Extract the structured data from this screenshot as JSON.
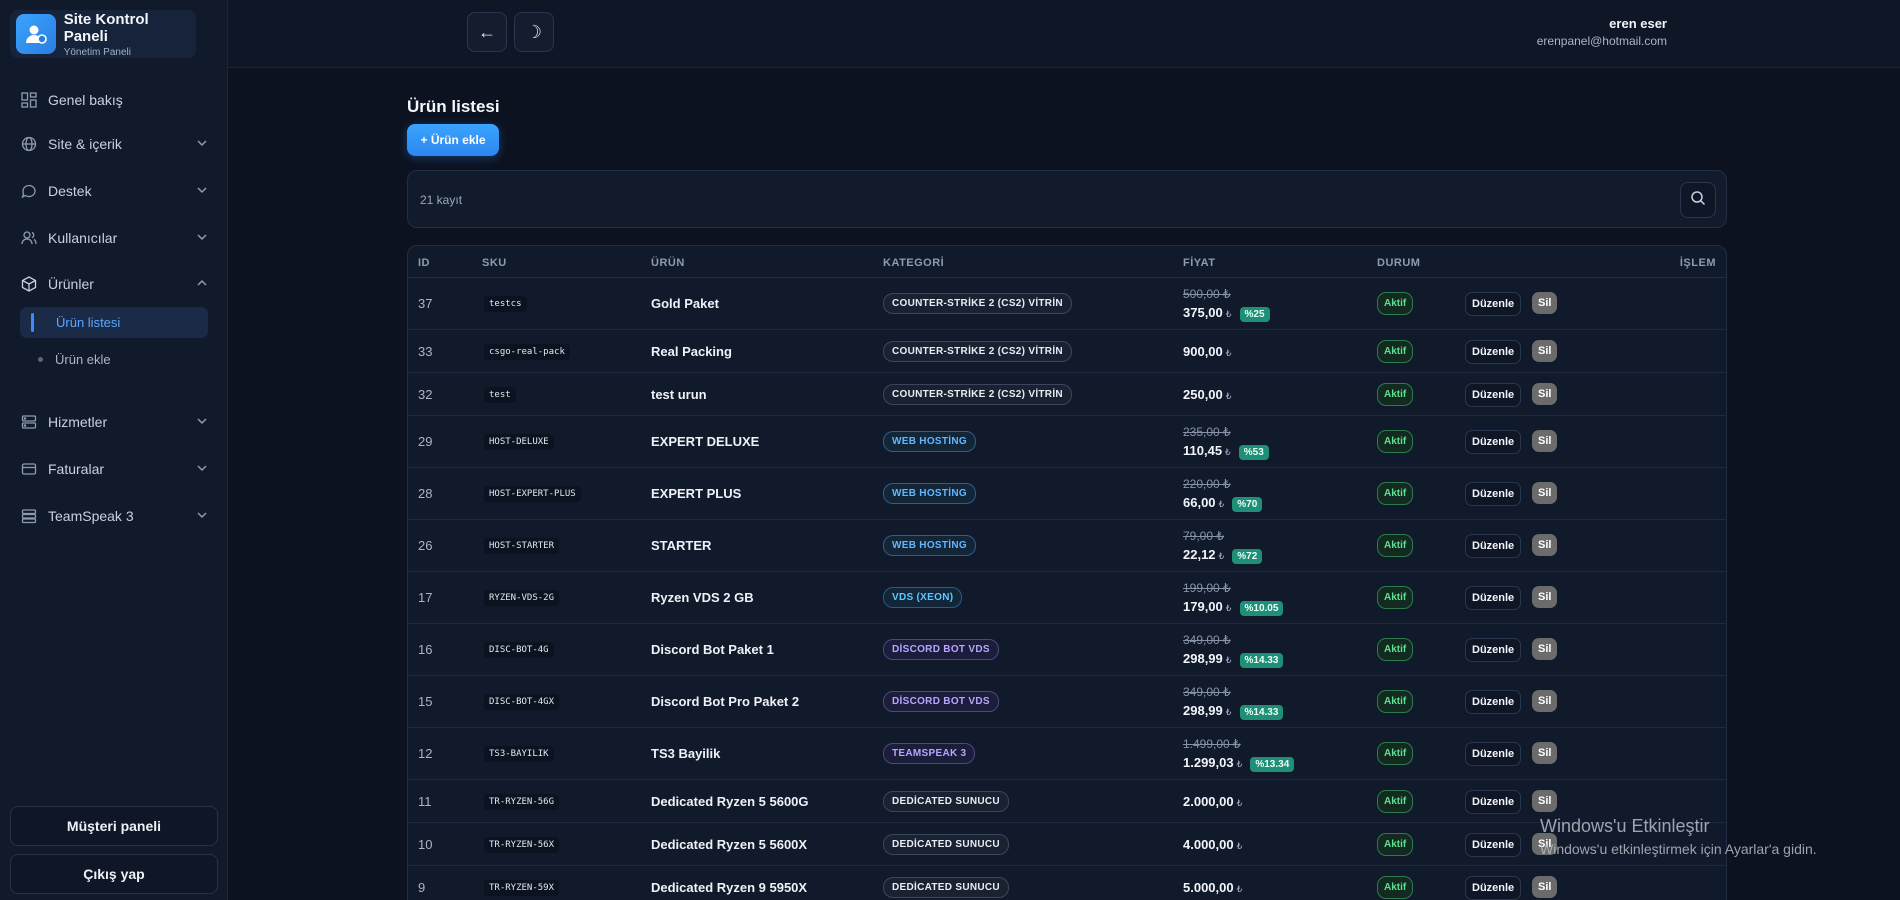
{
  "brand": {
    "title": "Site Kontrol Paneli",
    "subtitle": "Yönetim Paneli",
    "icon": "user-gear-icon"
  },
  "sidebar": {
    "items": [
      {
        "label": "Genel bakış",
        "icon": "grid-icon"
      },
      {
        "label": "Site & içerik",
        "icon": "globe-icon"
      },
      {
        "label": "Destek",
        "icon": "chat-icon"
      },
      {
        "label": "Kullanıcılar",
        "icon": "users-icon"
      },
      {
        "label": "Ürünler",
        "icon": "box-icon"
      },
      {
        "label": "Hizmetler",
        "icon": "server-icon"
      },
      {
        "label": "Faturalar",
        "icon": "invoice-icon"
      },
      {
        "label": "TeamSpeak 3",
        "icon": "teamspeak-icon"
      }
    ],
    "subitems": [
      {
        "label": "Ürün listesi",
        "active": true
      },
      {
        "label": "Ürün ekle",
        "active": false
      }
    ],
    "customer_panel": "Müşteri paneli",
    "logout": "Çıkış yap"
  },
  "topbar": {
    "back_icon": "←",
    "theme_icon": "☽",
    "user_name": "eren eser",
    "user_email": "erenpanel@hotmail.com"
  },
  "main": {
    "title": "Ürün listesi",
    "add_button": "+ Ürün ekle",
    "record_count": "21 kayıt",
    "columns": [
      "ID",
      "SKU",
      "ÜRÜN",
      "KATEGORİ",
      "FİYAT",
      "DURUM",
      "İŞLEM"
    ],
    "edit_label": "Düzenle",
    "delete_label": "Sil",
    "rows": [
      {
        "id": "37",
        "sku": "testcs",
        "name": "Gold Paket",
        "category": "COUNTER-STRİKE 2 (CS2) VİTRİN",
        "cat_style": "default",
        "old_price": "500,00 ₺",
        "price": "375,00",
        "currency": "₺",
        "discount": "%25",
        "status": "Aktif"
      },
      {
        "id": "33",
        "sku": "csgo-real-pack",
        "name": "Real Packing",
        "category": "COUNTER-STRİKE 2 (CS2) VİTRİN",
        "cat_style": "default",
        "old_price": "",
        "price": "900,00",
        "currency": "₺",
        "discount": "",
        "status": "Aktif"
      },
      {
        "id": "32",
        "sku": "test",
        "name": "test urun",
        "category": "COUNTER-STRİKE 2 (CS2) VİTRİN",
        "cat_style": "default",
        "old_price": "",
        "price": "250,00",
        "currency": "₺",
        "discount": "",
        "status": "Aktif"
      },
      {
        "id": "29",
        "sku": "HOST-DELUXE",
        "name": "EXPERT DELUXE",
        "category": "WEB HOSTİNG",
        "cat_style": "web",
        "old_price": "235,00 ₺",
        "price": "110,45",
        "currency": "₺",
        "discount": "%53",
        "status": "Aktif"
      },
      {
        "id": "28",
        "sku": "HOST-EXPERT-PLUS",
        "name": "EXPERT PLUS",
        "category": "WEB HOSTİNG",
        "cat_style": "web",
        "old_price": "220,00 ₺",
        "price": "66,00",
        "currency": "₺",
        "discount": "%70",
        "status": "Aktif"
      },
      {
        "id": "26",
        "sku": "HOST-STARTER",
        "name": "STARTER",
        "category": "WEB HOSTİNG",
        "cat_style": "web",
        "old_price": "79,00 ₺",
        "price": "22,12",
        "currency": "₺",
        "discount": "%72",
        "status": "Aktif"
      },
      {
        "id": "17",
        "sku": "RYZEN-VDS-2G",
        "name": "Ryzen VDS 2 GB",
        "category": "VDS (XEON)",
        "cat_style": "vds",
        "old_price": "199,00 ₺",
        "price": "179,00",
        "currency": "₺",
        "discount": "%10.05",
        "status": "Aktif"
      },
      {
        "id": "16",
        "sku": "DISC-BOT-4G",
        "name": "Discord Bot Paket 1",
        "category": "DİSCORD BOT VDS",
        "cat_style": "disc",
        "old_price": "349,00 ₺",
        "price": "298,99",
        "currency": "₺",
        "discount": "%14.33",
        "status": "Aktif"
      },
      {
        "id": "15",
        "sku": "DISC-BOT-4GX",
        "name": "Discord Bot Pro Paket 2",
        "category": "DİSCORD BOT VDS",
        "cat_style": "disc",
        "old_price": "349,00 ₺",
        "price": "298,99",
        "currency": "₺",
        "discount": "%14.33",
        "status": "Aktif"
      },
      {
        "id": "12",
        "sku": "TS3-BAYILIK",
        "name": "TS3 Bayilik",
        "category": "TEAMSPEAK 3",
        "cat_style": "ts",
        "old_price": "1.499,00 ₺",
        "price": "1.299,03",
        "currency": "₺",
        "discount": "%13.34",
        "status": "Aktif"
      },
      {
        "id": "11",
        "sku": "TR-RYZEN-56G",
        "name": "Dedicated Ryzen 5 5600G",
        "category": "DEDİCATED SUNUCU",
        "cat_style": "default",
        "old_price": "",
        "price": "2.000,00",
        "currency": "₺",
        "discount": "",
        "status": "Aktif"
      },
      {
        "id": "10",
        "sku": "TR-RYZEN-56X",
        "name": "Dedicated Ryzen 5 5600X",
        "category": "DEDİCATED SUNUCU",
        "cat_style": "default",
        "old_price": "",
        "price": "4.000,00",
        "currency": "₺",
        "discount": "",
        "status": "Aktif"
      },
      {
        "id": "9",
        "sku": "TR-RYZEN-59X",
        "name": "Dedicated Ryzen 9 5950X",
        "category": "DEDİCATED SUNUCU",
        "cat_style": "default",
        "old_price": "",
        "price": "5.000,00",
        "currency": "₺",
        "discount": "",
        "status": "Aktif"
      }
    ]
  },
  "watermark": {
    "title": "Windows'u Etkinleştir",
    "subtitle": "Windows'u etkinleştirmek için Ayarlar'a gidin."
  },
  "colors": {
    "accent": "#3aa4ff",
    "active_status": "#5ee08e",
    "discount": "#1f8f78",
    "background": "#0c1220"
  }
}
